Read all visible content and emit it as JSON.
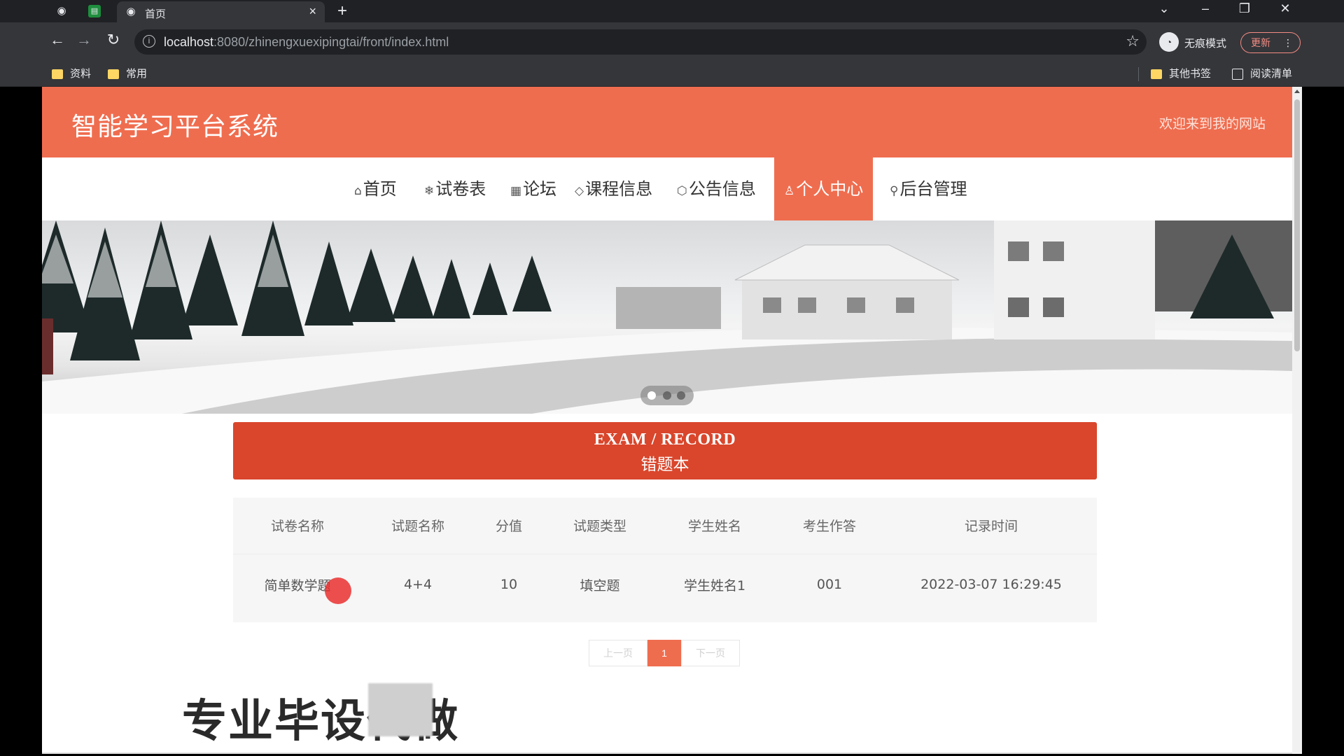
{
  "browser": {
    "tab_title": "首页",
    "tab_close": "×",
    "new_tab": "+",
    "url_host": "localhost",
    "url_rest": ":8080/zhinengxuexipingtai/front/index.html",
    "incognito_label": "无痕模式",
    "update_label": "更新",
    "bookmarks": [
      "资料",
      "常用"
    ],
    "other_bookmarks": "其他书签",
    "reading_list": "阅读清单"
  },
  "site": {
    "title": "智能学习平台系统",
    "welcome": "欢迎来到我的网站"
  },
  "nav": {
    "items": [
      {
        "icon": "⌂",
        "label": "首页"
      },
      {
        "icon": "❄",
        "label": "试卷表"
      },
      {
        "icon": "▦",
        "label": "论坛"
      },
      {
        "icon": "◇",
        "label": "课程信息"
      },
      {
        "icon": "⬡",
        "label": "公告信息"
      },
      {
        "icon": "♙",
        "label": "个人中心"
      },
      {
        "icon": "⚲",
        "label": "后台管理"
      }
    ],
    "active_index": 5
  },
  "banner": {
    "dot_count": 3,
    "active_dot": 0
  },
  "section": {
    "title_en": "EXAM / RECORD",
    "title_cn": "错题本"
  },
  "table": {
    "headers": [
      "试卷名称",
      "试题名称",
      "分值",
      "试题类型",
      "学生姓名",
      "考生作答",
      "记录时间"
    ],
    "rows": [
      [
        "简单数学题",
        "4+4",
        "10",
        "填空题",
        "学生姓名1",
        "001",
        "2022-03-07 16:29:45"
      ]
    ]
  },
  "pager": {
    "prev": "上一页",
    "current": "1",
    "next": "下一页"
  },
  "overlay": {
    "watermark": "专业毕设代做"
  },
  "colors": {
    "brand": "#ef6d4f",
    "section_header": "#d9462c"
  }
}
